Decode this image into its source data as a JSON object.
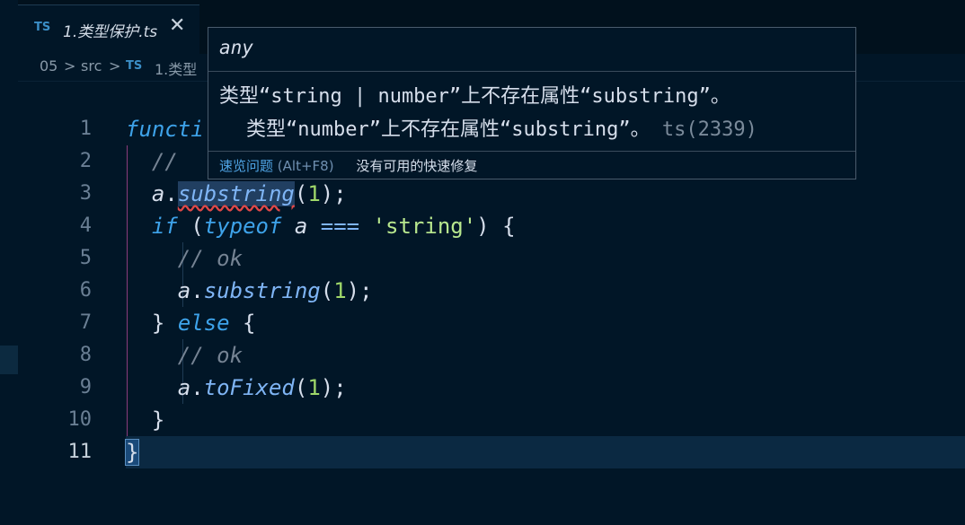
{
  "tab": {
    "badge": "TS",
    "filename": "1.类型保护.ts",
    "close": "✕"
  },
  "breadcrumb": {
    "items": [
      "05",
      "src",
      "1.类型(...)"
    ],
    "sep": ">",
    "badge": "TS",
    "file": "1.类型"
  },
  "hover": {
    "signature": "any",
    "message_line1": "类型“string | number”上不存在属性“substring”。",
    "message_line2": "类型“number”上不存在属性“substring”。",
    "error_code": "ts(2339)",
    "action_peek": "速览问题",
    "action_peek_key": "(Alt+F8)",
    "action_nofix": "没有可用的快速修复"
  },
  "code": {
    "line_numbers": [
      "1",
      "2",
      "3",
      "4",
      "5",
      "6",
      "7",
      "8",
      "9",
      "10",
      "11"
    ],
    "l1_kw": "functi",
    "l2_cmt": "//",
    "l3_var": "a",
    "l3_dot": ".",
    "l3_method": "substring",
    "l3_open": "(",
    "l3_num": "1",
    "l3_close": ");",
    "l4_if": "if",
    "l4_open": " (",
    "l4_typeof": "typeof",
    "l4_a": " a",
    "l4_op": " ===",
    "l4_str": " 'string'",
    "l4_close": ") {",
    "l5_cmt": "// ok",
    "l6_var": "a",
    "l6_dot": ".",
    "l6_method": "substring",
    "l6_open": "(",
    "l6_num": "1",
    "l6_close": ");",
    "l7_brace": "} ",
    "l7_else": "else",
    "l7_open": " {",
    "l8_cmt": "// ok",
    "l9_var": "a",
    "l9_dot": ".",
    "l9_method": "toFixed",
    "l9_open": "(",
    "l9_num": "1",
    "l9_close": ");",
    "l10_brace": "}",
    "l11_brace": "}"
  }
}
